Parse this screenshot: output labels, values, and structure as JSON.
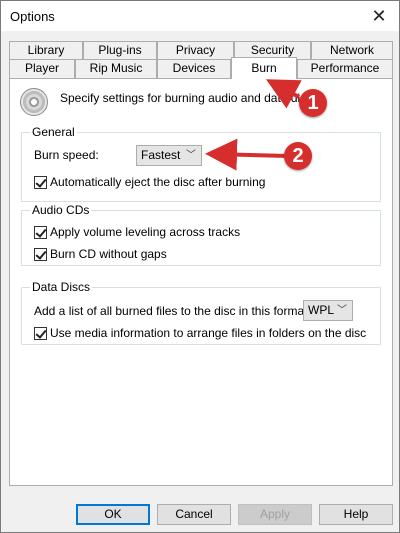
{
  "window": {
    "title": "Options",
    "close_glyph": "✕"
  },
  "tabs": {
    "row1": [
      "Library",
      "Plug-ins",
      "Privacy",
      "Security",
      "Network"
    ],
    "row2": [
      "Player",
      "Rip Music",
      "Devices",
      "Burn",
      "Performance"
    ],
    "active": "Burn"
  },
  "intro": {
    "text": "Specify settings for burning audio and data discs",
    "icon": "disc-icon"
  },
  "general": {
    "legend": "General",
    "burn_speed_label": "Burn speed:",
    "burn_speed_value": "Fastest",
    "auto_eject_label": "Automatically eject the disc after burning",
    "auto_eject_checked": true
  },
  "audio_cds": {
    "legend": "Audio CDs",
    "volume_leveling_label": "Apply volume leveling across tracks",
    "volume_leveling_checked": true,
    "without_gaps_label": "Burn CD without gaps",
    "without_gaps_checked": true
  },
  "data_discs": {
    "legend": "Data Discs",
    "list_format_label": "Add a list of all burned files to the disc in this format:",
    "list_format_value": "WPL",
    "media_info_label": "Use media information to arrange files in folders on the disc",
    "media_info_checked": true
  },
  "buttons": {
    "ok": "OK",
    "cancel": "Cancel",
    "apply": "Apply",
    "help": "Help"
  },
  "annotations": {
    "marker1": "1",
    "marker2": "2",
    "color": "#d62d2d"
  }
}
